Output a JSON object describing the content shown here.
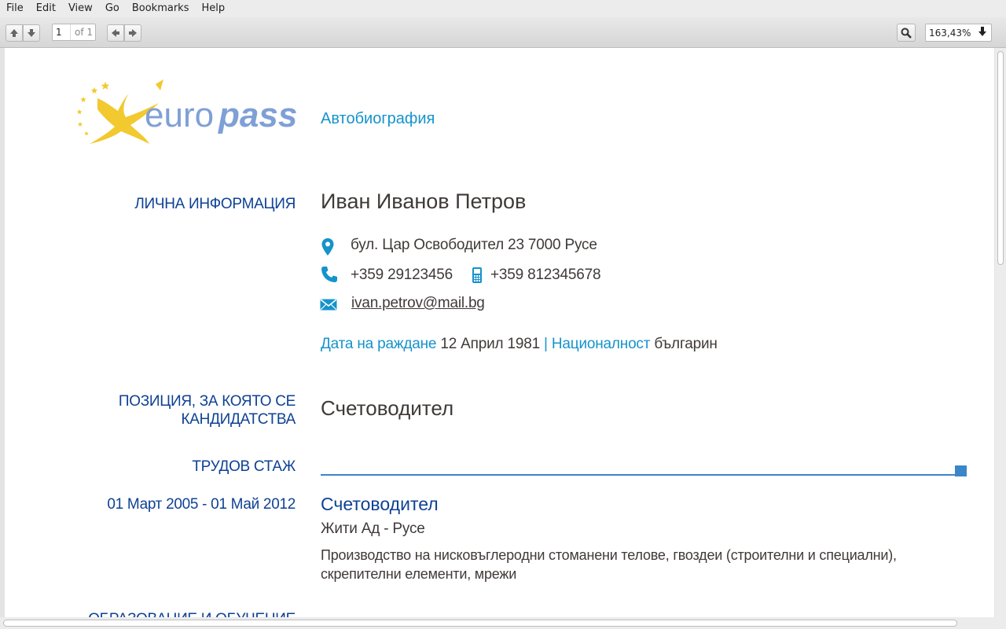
{
  "menu": [
    "File",
    "Edit",
    "View",
    "Go",
    "Bookmarks",
    "Help"
  ],
  "toolbar": {
    "page_current": "1",
    "page_of": "of 1",
    "zoom": "163,43%"
  },
  "cv": {
    "logo_text_euro": "euro",
    "logo_text_pass": "pass",
    "doc_title": "Автобиография",
    "personal": {
      "heading": "ЛИЧНА ИНФОРМАЦИЯ",
      "name": "Иван Иванов Петров",
      "address": "бул. Цар Освободител 23 7000 Русе",
      "phone": "+359 29123456",
      "mobile": "+359 812345678",
      "email": "ivan.petrov@mail.bg",
      "birth_label": "Дата на раждане",
      "birth_value": "12 Април 1981",
      "separator": "|",
      "nationality_label": "Националност",
      "nationality_value": "българин"
    },
    "position": {
      "heading_line1": "ПОЗИЦИЯ, ЗА КОЯТО СЕ",
      "heading_line2": "КАНДИДАТСТВА",
      "value": "Счетоводител"
    },
    "work": {
      "heading": "ТРУДОВ СТАЖ",
      "dates": "01 Март 2005 - 01 Май 2012",
      "title": "Счетоводител",
      "employer": "Жити Ад - Русе",
      "desc_line1": "Производство на нисковъглеродни стоманени телове, гвоздеи (строителни и специални),",
      "desc_line2": "скрепителни елементи, мрежи"
    },
    "next_heading_partial": "ОБРАЗОВАНИЕ И ОБУЧЕНИЕ"
  },
  "colors": {
    "heading_blue": "#0e4194",
    "accent_blue": "#1593cb",
    "logo_yellow": "#f2c92e",
    "logo_blue": "#7fa0d6"
  }
}
